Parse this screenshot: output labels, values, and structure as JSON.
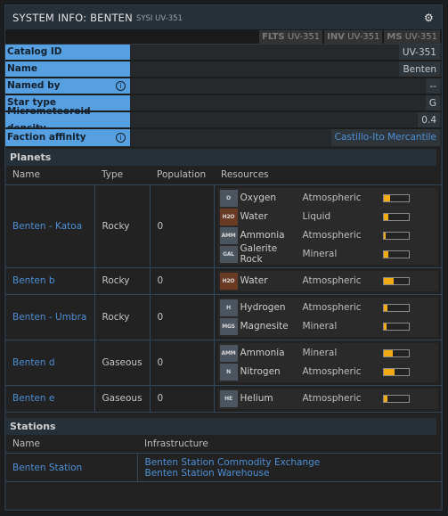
{
  "window": {
    "title": "SYSTEM INFO: BENTEN",
    "subtitle": "SYSI UV-351",
    "settings_icon": "gear-icon"
  },
  "codes": [
    {
      "key": "FLTS",
      "value": "UV-351"
    },
    {
      "key": "INV",
      "value": "UV-351"
    },
    {
      "key": "MS",
      "value": "UV-351"
    }
  ],
  "info": [
    {
      "label": "Catalog ID",
      "value": "UV-351",
      "has_info": false,
      "link": false
    },
    {
      "label": "Name",
      "value": "Benten",
      "has_info": false,
      "link": false
    },
    {
      "label": "Named by",
      "value": "--",
      "has_info": true,
      "link": false
    },
    {
      "label": "Star type",
      "value": "G",
      "has_info": false,
      "link": false
    },
    {
      "label": "Micrometeoroid density",
      "value": "0.4",
      "has_info": false,
      "link": false
    },
    {
      "label": "Faction affinity",
      "value": "Castillo-Ito Mercantile",
      "has_info": true,
      "link": true
    }
  ],
  "planets": {
    "header": "Planets",
    "columns": [
      "Name",
      "Type",
      "Population",
      "Resources"
    ],
    "rows": [
      {
        "name": "Benten - Katoa",
        "type": "Rocky",
        "population": "0",
        "resources": [
          {
            "badge": "O",
            "name": "Oxygen",
            "kind": "Atmospheric",
            "level": 0.27,
            "color": "#4a5560"
          },
          {
            "badge": "H2O",
            "name": "Water",
            "kind": "Liquid",
            "level": 0.2,
            "color": "#6b3a22"
          },
          {
            "badge": "AMM",
            "name": "Ammonia",
            "kind": "Atmospheric",
            "level": 0.1,
            "color": "#4a5560"
          },
          {
            "badge": "GAL",
            "name": "Galerite Rock",
            "kind": "Mineral",
            "level": 0.2,
            "color": "#4a5560"
          }
        ]
      },
      {
        "name": "Benten b",
        "type": "Rocky",
        "population": "0",
        "resources": [
          {
            "badge": "H2O",
            "name": "Water",
            "kind": "Atmospheric",
            "level": 0.42,
            "color": "#6b3a22"
          }
        ]
      },
      {
        "name": "Benten - Umbra",
        "type": "Rocky",
        "population": "0",
        "resources": [
          {
            "badge": "H",
            "name": "Hydrogen",
            "kind": "Atmospheric",
            "level": 0.17,
            "color": "#4a5560"
          },
          {
            "badge": "MGS",
            "name": "Magnesite",
            "kind": "Mineral",
            "level": 0.13,
            "color": "#4a5560"
          }
        ]
      },
      {
        "name": "Benten d",
        "type": "Gaseous",
        "population": "0",
        "resources": [
          {
            "badge": "AMM",
            "name": "Ammonia",
            "kind": "Mineral",
            "level": 0.38,
            "color": "#4a5560"
          },
          {
            "badge": "N",
            "name": "Nitrogen",
            "kind": "Atmospheric",
            "level": 0.45,
            "color": "#4a5560"
          }
        ]
      },
      {
        "name": "Benten e",
        "type": "Gaseous",
        "population": "0",
        "resources": [
          {
            "badge": "HE",
            "name": "Helium",
            "kind": "Atmospheric",
            "level": 0.17,
            "color": "#4a5560"
          }
        ]
      }
    ]
  },
  "stations": {
    "header": "Stations",
    "columns": [
      "Name",
      "Infrastructure"
    ],
    "rows": [
      {
        "name": "Benten Station",
        "infrastructure": [
          "Benten Station Commodity Exchange",
          "Benten Station Warehouse"
        ]
      }
    ]
  }
}
